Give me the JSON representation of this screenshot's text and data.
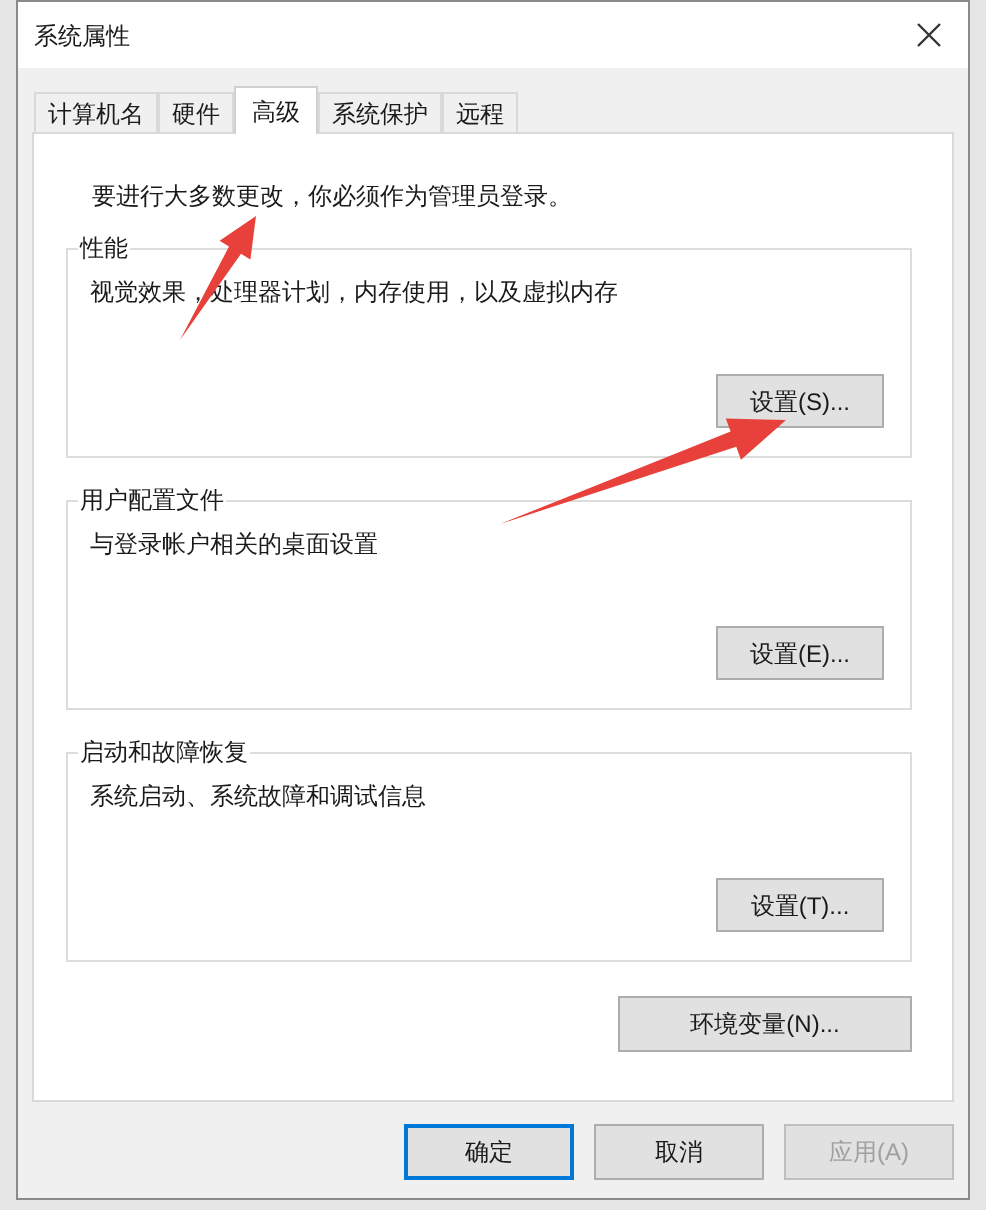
{
  "window": {
    "title": "系统属性"
  },
  "tabs": [
    {
      "label": "计算机名",
      "selected": false
    },
    {
      "label": "硬件",
      "selected": false
    },
    {
      "label": "高级",
      "selected": true
    },
    {
      "label": "系统保护",
      "selected": false
    },
    {
      "label": "远程",
      "selected": false
    }
  ],
  "notice": "要进行大多数更改，你必须作为管理员登录。",
  "groups": [
    {
      "title": "性能",
      "description": "视觉效果，处理器计划，内存使用，以及虚拟内存",
      "button": "设置(S)..."
    },
    {
      "title": "用户配置文件",
      "description": "与登录帐户相关的桌面设置",
      "button": "设置(E)..."
    },
    {
      "title": "启动和故障恢复",
      "description": "系统启动、系统故障和调试信息",
      "button": "设置(T)..."
    }
  ],
  "env_button": "环境变量(N)...",
  "buttons": [
    {
      "label": "确定",
      "default": true,
      "disabled": false
    },
    {
      "label": "取消",
      "default": false,
      "disabled": false
    },
    {
      "label": "应用(A)",
      "default": false,
      "disabled": true
    }
  ]
}
